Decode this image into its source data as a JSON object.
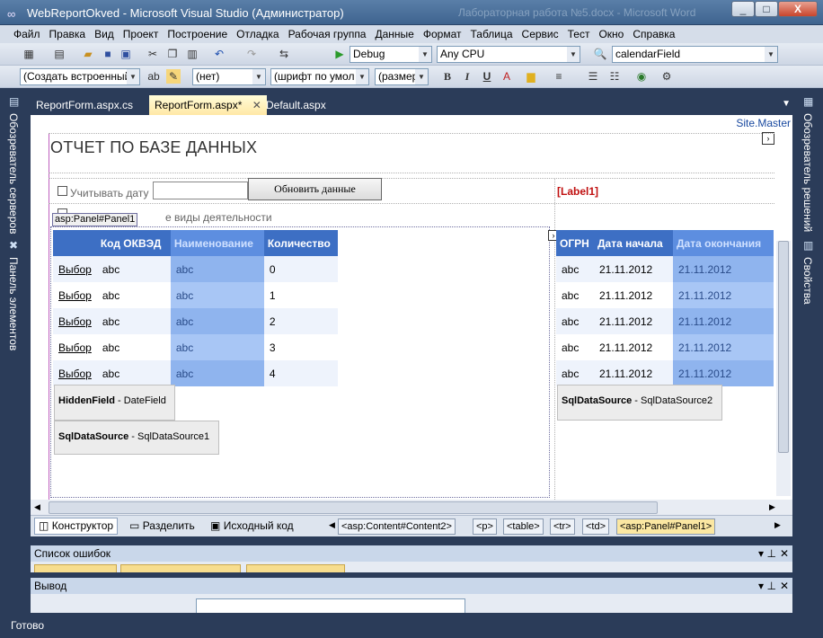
{
  "window": {
    "title": "WebReportOkved - Microsoft Visual Studio (Администратор)",
    "blurred_title": "Лабораторная работа №5.docx - Microsoft Word",
    "controls": [
      "_",
      "□",
      "X"
    ]
  },
  "menu": [
    "Файл",
    "Правка",
    "Вид",
    "Проект",
    "Построение",
    "Отладка",
    "Рабочая группа",
    "Данные",
    "Формат",
    "Таблица",
    "Сервис",
    "Тест",
    "Окно",
    "Справка"
  ],
  "toolbar1": {
    "config": "Debug",
    "platform": "Any CPU",
    "find": "calendarField"
  },
  "toolbar2": {
    "style": "(Создать встроенный",
    "block": "(нет)",
    "font": "(шрифт по умол",
    "size": "(размер",
    "bold": "B",
    "italic": "I",
    "underline": "U"
  },
  "left_panels": [
    "Обозреватель серверов",
    "Панель элементов"
  ],
  "right_panels": [
    "Обозреватель решений",
    "Свойства"
  ],
  "tabs": [
    "ReportForm.aspx.cs",
    "ReportForm.aspx*",
    "Default.aspx"
  ],
  "editor": {
    "site_master": "Site.Master",
    "heading": "ОТЧЕТ ПО БАЗЕ ДАННЫХ",
    "checkbox_date": "Учитывать дату",
    "refresh_button": "Обновить данные",
    "label1": "[Label1]",
    "panel_tag": "asp:Panel#Panel1",
    "checkbox_activity": "е виды деятельности",
    "grid1": {
      "headers": [
        "Код ОКВЭД",
        "Наименование",
        "Количество"
      ],
      "rows": [
        {
          "link": "Выбор",
          "code": "abc",
          "name": "abc",
          "count": "0"
        },
        {
          "link": "Выбор",
          "code": "abc",
          "name": "abc",
          "count": "1"
        },
        {
          "link": "Выбор",
          "code": "abc",
          "name": "abc",
          "count": "2"
        },
        {
          "link": "Выбор",
          "code": "abc",
          "name": "abc",
          "count": "3"
        },
        {
          "link": "Выбор",
          "code": "abc",
          "name": "abc",
          "count": "4"
        }
      ]
    },
    "grid2": {
      "headers": [
        "ОГРН",
        "Дата начала",
        "Дата окончания"
      ],
      "rows": [
        {
          "ogrn": "abc",
          "start": "21.11.2012",
          "end": "21.11.2012"
        },
        {
          "ogrn": "abc",
          "start": "21.11.2012",
          "end": "21.11.2012"
        },
        {
          "ogrn": "abc",
          "start": "21.11.2012",
          "end": "21.11.2012"
        },
        {
          "ogrn": "abc",
          "start": "21.11.2012",
          "end": "21.11.2012"
        },
        {
          "ogrn": "abc",
          "start": "21.11.2012",
          "end": "21.11.2012"
        }
      ]
    },
    "hidden_field": {
      "type": "HiddenField",
      "name": "DateField"
    },
    "datasource1": {
      "type": "SqlDataSource",
      "name": "SqlDataSource1"
    },
    "datasource2": {
      "type": "SqlDataSource",
      "name": "SqlDataSource2"
    }
  },
  "viewbar": {
    "design": "Конструктор",
    "split": "Разделить",
    "source": "Исходный код",
    "breadcrumbs": [
      "<asp:Content#Content2>",
      "<p>",
      "<table>",
      "<tr>",
      "<td>",
      "<asp:Panel#Panel1>"
    ]
  },
  "panes": {
    "errors": "Список ошибок",
    "output": "Вывод"
  },
  "status": "Готово"
}
